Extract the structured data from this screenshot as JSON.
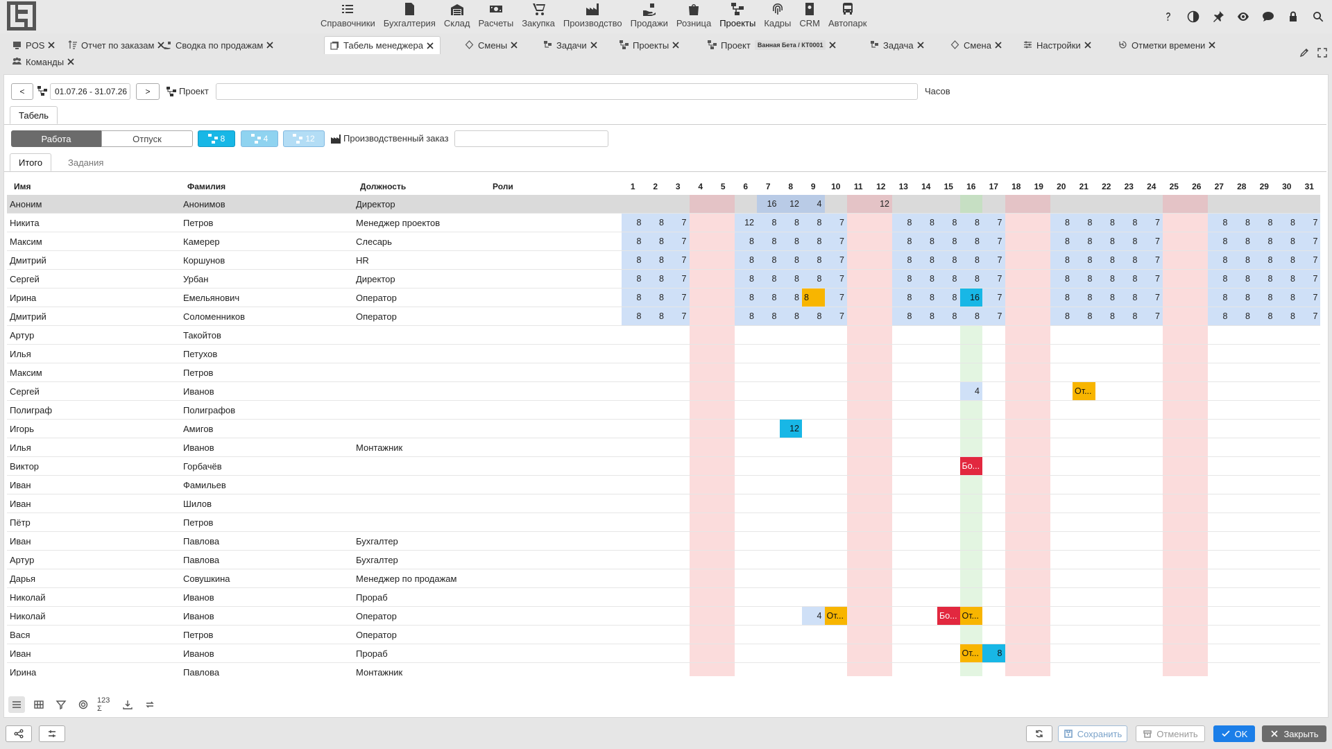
{
  "nav": {
    "modules": [
      {
        "label": "Справочники",
        "icon": "list-icon"
      },
      {
        "label": "Бухгалтерия",
        "icon": "document-icon"
      },
      {
        "label": "Склад",
        "icon": "warehouse-icon"
      },
      {
        "label": "Расчеты",
        "icon": "money-icon"
      },
      {
        "label": "Закупка",
        "icon": "cart-icon"
      },
      {
        "label": "Производство",
        "icon": "factory-icon"
      },
      {
        "label": "Продажи",
        "icon": "hand-money-icon"
      },
      {
        "label": "Розница",
        "icon": "shopping-bag-icon"
      },
      {
        "label": "Проекты",
        "icon": "project-icon"
      },
      {
        "label": "Кадры",
        "icon": "fingerprint-icon"
      },
      {
        "label": "CRM",
        "icon": "crm-icon"
      },
      {
        "label": "Автопарк",
        "icon": "bus-icon"
      }
    ]
  },
  "tabs": [
    {
      "label": "POS",
      "icon": "pos-icon"
    },
    {
      "label": "Отчет по заказам",
      "icon": "sort-icon"
    },
    {
      "label": "Сводка по продажам",
      "icon": "sales-icon"
    },
    {
      "label": "Табель менеджера",
      "icon": "timesheet-icon"
    },
    {
      "label": "Смены",
      "icon": "shift-icon"
    },
    {
      "label": "Задачи",
      "icon": "task-icon"
    },
    {
      "label": "Проекты",
      "icon": "project-icon"
    },
    {
      "label": "Проект",
      "icon": "project-icon",
      "badge": "Ванная Бета / КТ0001"
    },
    {
      "label": "Задача",
      "icon": "task-icon"
    },
    {
      "label": "Смена",
      "icon": "shift-icon"
    },
    {
      "label": "Настройки",
      "icon": "settings-icon"
    },
    {
      "label": "Отметки времени",
      "icon": "history-icon"
    },
    {
      "label": "Команды",
      "icon": "team-icon"
    }
  ],
  "filters": {
    "prev": "<",
    "next": ">",
    "period": "01.07.26 - 31.07.26",
    "project_label": "Проект",
    "project_value": "",
    "hours_label": "Часов",
    "order_label": "Производственный заказ",
    "order_value": ""
  },
  "main_tab": "Табель",
  "mode": {
    "work": "Работа",
    "vacation": "Отпуск"
  },
  "pills": [
    {
      "value": "8",
      "color": "#18b7e6"
    },
    {
      "value": "4",
      "color": "#8fd3f0"
    },
    {
      "value": "12",
      "color": "#b3ddf5"
    }
  ],
  "subtabs": {
    "total": "Итого",
    "tasks": "Задания"
  },
  "columns": {
    "name": "Имя",
    "surname": "Фамилия",
    "position": "Должность",
    "roles": "Роли"
  },
  "days": [
    "1",
    "2",
    "3",
    "4",
    "5",
    "6",
    "7",
    "8",
    "9",
    "10",
    "11",
    "12",
    "13",
    "14",
    "15",
    "16",
    "17",
    "18",
    "19",
    "20",
    "21",
    "22",
    "23",
    "24",
    "25",
    "26",
    "27",
    "28",
    "29",
    "30",
    "31"
  ],
  "weekend_days": [
    4,
    5,
    11,
    12,
    18,
    19,
    25,
    26
  ],
  "holiday_day": 16,
  "rows": [
    {
      "name": "Аноним",
      "surname": "Анонимов",
      "position": "Директор",
      "selected": true,
      "hours": {
        "7": "16",
        "8": "12",
        "9": "4",
        "12": "12"
      }
    },
    {
      "name": "Никита",
      "surname": "Петров",
      "position": "Менеджер проектов",
      "full": true,
      "hours": {
        "1": "8",
        "2": "8",
        "3": "7",
        "6": "12",
        "7": "8",
        "8": "8",
        "9": "8",
        "10": "7",
        "13": "8",
        "14": "8",
        "15": "8",
        "16": "8",
        "17": "7",
        "20": "8",
        "21": "8",
        "22": "8",
        "23": "8",
        "24": "7",
        "27": "8",
        "28": "8",
        "29": "8",
        "30": "8",
        "31": "7"
      }
    },
    {
      "name": "Максим",
      "surname": "Камерер",
      "position": "Слесарь",
      "full": true,
      "hours": {
        "1": "8",
        "2": "8",
        "3": "7",
        "6": "8",
        "7": "8",
        "8": "8",
        "9": "8",
        "10": "7",
        "13": "8",
        "14": "8",
        "15": "8",
        "16": "8",
        "17": "7",
        "20": "8",
        "21": "8",
        "22": "8",
        "23": "8",
        "24": "7",
        "27": "8",
        "28": "8",
        "29": "8",
        "30": "8",
        "31": "7"
      }
    },
    {
      "name": "Дмитрий",
      "surname": "Коршунов",
      "position": "HR",
      "full": true,
      "hours": {
        "1": "8",
        "2": "8",
        "3": "7",
        "6": "8",
        "7": "8",
        "8": "8",
        "9": "8",
        "10": "7",
        "13": "8",
        "14": "8",
        "15": "8",
        "16": "8",
        "17": "7",
        "20": "8",
        "21": "8",
        "22": "8",
        "23": "8",
        "24": "7",
        "27": "8",
        "28": "8",
        "29": "8",
        "30": "8",
        "31": "7"
      }
    },
    {
      "name": "Сергей",
      "surname": "Урбан",
      "position": "Директор",
      "full": true,
      "hours": {
        "1": "8",
        "2": "8",
        "3": "7",
        "6": "8",
        "7": "8",
        "8": "8",
        "9": "8",
        "10": "7",
        "13": "8",
        "14": "8",
        "15": "8",
        "16": "8",
        "17": "7",
        "20": "8",
        "21": "8",
        "22": "8",
        "23": "8",
        "24": "7",
        "27": "8",
        "28": "8",
        "29": "8",
        "30": "8",
        "31": "7"
      }
    },
    {
      "name": "Ирина",
      "surname": "Емельянович",
      "position": "Оператор",
      "full": true,
      "hours": {
        "1": "8",
        "2": "8",
        "3": "7",
        "6": "8",
        "7": "8",
        "8": "8",
        "9": "8",
        "10": "7",
        "13": "8",
        "14": "8",
        "15": "8",
        "16": "16",
        "17": "7",
        "20": "8",
        "21": "8",
        "22": "8",
        "23": "8",
        "24": "7",
        "27": "8",
        "28": "8",
        "29": "8",
        "30": "8",
        "31": "7"
      },
      "special": {
        "9": "or",
        "16": "cy"
      }
    },
    {
      "name": "Дмитрий",
      "surname": "Соломенников",
      "position": "Оператор",
      "full": true,
      "hours": {
        "1": "8",
        "2": "8",
        "3": "7",
        "6": "8",
        "7": "8",
        "8": "8",
        "9": "8",
        "10": "7",
        "13": "8",
        "14": "8",
        "15": "8",
        "16": "8",
        "17": "7",
        "20": "8",
        "21": "8",
        "22": "8",
        "23": "8",
        "24": "7",
        "27": "8",
        "28": "8",
        "29": "8",
        "30": "8",
        "31": "7"
      }
    },
    {
      "name": "Артур",
      "surname": "Такойтов",
      "position": "",
      "hours": {}
    },
    {
      "name": "Илья",
      "surname": "Петухов",
      "position": "",
      "hours": {}
    },
    {
      "name": "Максим",
      "surname": "Петров",
      "position": "",
      "hours": {}
    },
    {
      "name": "Сергей",
      "surname": "Иванов",
      "position": "",
      "hours": {
        "16": "4",
        "21": "От..."
      },
      "special": {
        "16": "lb",
        "21": "or"
      }
    },
    {
      "name": "Полиграф",
      "surname": "Полиграфов",
      "position": "",
      "hours": {}
    },
    {
      "name": "Игорь",
      "surname": "Амигов",
      "position": "",
      "hours": {
        "8": "12"
      },
      "special": {
        "8": "cy"
      }
    },
    {
      "name": "Илья",
      "surname": "Иванов",
      "position": "Монтажник",
      "hours": {}
    },
    {
      "name": "Виктор",
      "surname": "Горбачёв",
      "position": "",
      "hours": {
        "16": "Бо..."
      },
      "special": {
        "16": "rd"
      }
    },
    {
      "name": "Иван",
      "surname": "Фамильев",
      "position": "",
      "hours": {}
    },
    {
      "name": "Иван",
      "surname": "Шилов",
      "position": "",
      "hours": {}
    },
    {
      "name": "Пётр",
      "surname": "Петров",
      "position": "",
      "hours": {}
    },
    {
      "name": "Иван",
      "surname": "Павлова",
      "position": "Бухгалтер",
      "hours": {}
    },
    {
      "name": "Артур",
      "surname": "Павлова",
      "position": "Бухгалтер",
      "hours": {}
    },
    {
      "name": "Дарья",
      "surname": "Совушкина",
      "position": "Менеджер по продажам",
      "hours": {}
    },
    {
      "name": "Николай",
      "surname": "Иванов",
      "position": "Прораб",
      "hours": {}
    },
    {
      "name": "Николай",
      "surname": "Иванов",
      "position": "Оператор",
      "hours": {
        "9": "4",
        "10": "От...",
        "15": "Бо...",
        "16": "От..."
      },
      "special": {
        "9": "lb",
        "10": "or",
        "15": "rd",
        "16": "or"
      }
    },
    {
      "name": "Вася",
      "surname": "Петров",
      "position": "Оператор",
      "hours": {}
    },
    {
      "name": "Иван",
      "surname": "Иванов",
      "position": "Прораб",
      "hours": {
        "16": "От...",
        "17": "8"
      },
      "special": {
        "16": "or",
        "17": "cy"
      }
    },
    {
      "name": "Ирина",
      "surname": "Павлова",
      "position": "Монтажник",
      "hours": {}
    }
  ],
  "footer": {
    "save": "Сохранить",
    "cancel": "Отменить",
    "ok": "OK",
    "close": "Закрыть"
  }
}
